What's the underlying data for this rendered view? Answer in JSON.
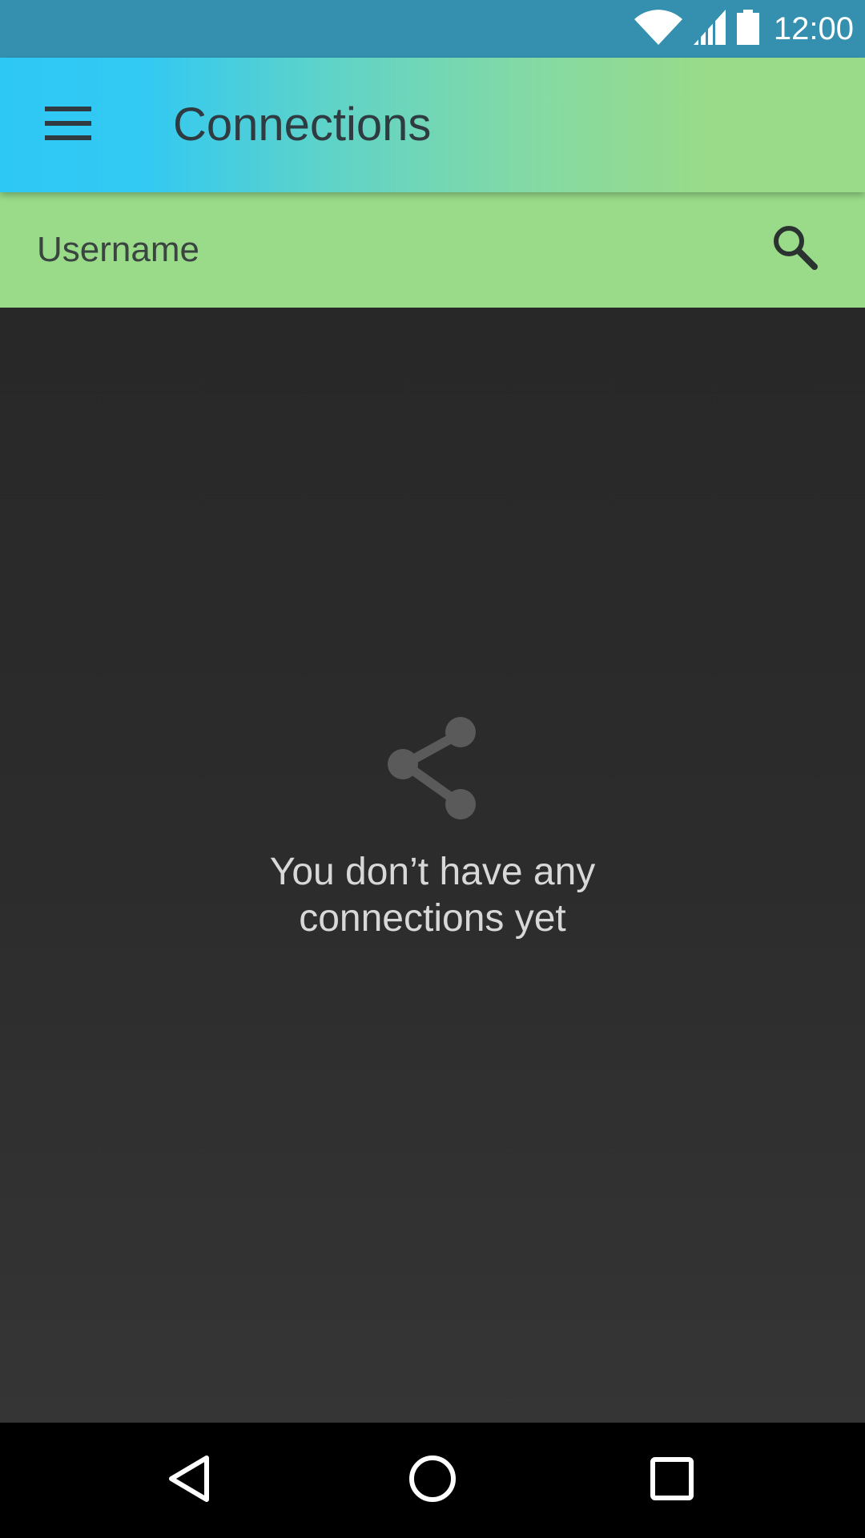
{
  "status_bar": {
    "time": "12:00",
    "icons": [
      "wifi-icon",
      "cellular-signal-icon",
      "battery-icon"
    ],
    "background": "#3590b0"
  },
  "app_bar": {
    "title": "Connections",
    "menu_icon": "hamburger-menu-icon",
    "gradient": [
      "#2ec8f5",
      "#99db89"
    ]
  },
  "search": {
    "placeholder": "Username",
    "value": "",
    "icon": "search-icon",
    "background": "#99db89"
  },
  "empty_state": {
    "icon": "share-icon",
    "line1": "You don’t have any",
    "line2": "connections yet"
  },
  "nav_bar": {
    "buttons": [
      "back-icon",
      "home-icon",
      "recents-icon"
    ]
  }
}
